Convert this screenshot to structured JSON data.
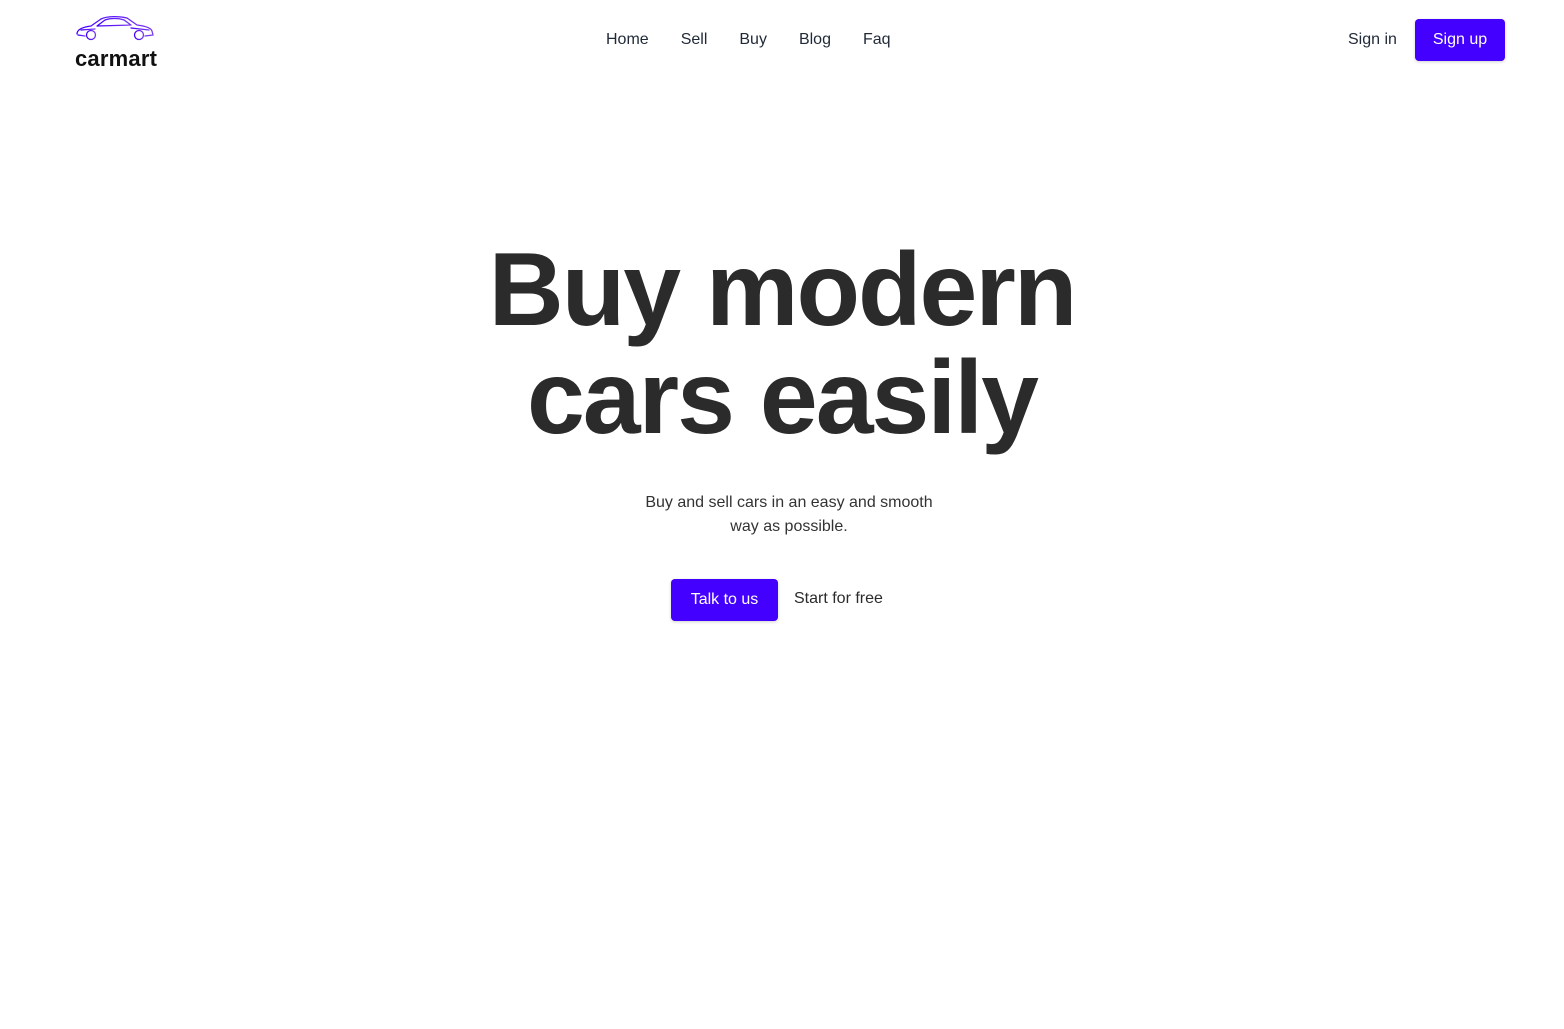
{
  "brand": {
    "name": "carmart",
    "logo_icon": "car-outline-icon",
    "logo_color": "#4300ff"
  },
  "nav": {
    "items": [
      {
        "label": "Home"
      },
      {
        "label": "Sell"
      },
      {
        "label": "Buy"
      },
      {
        "label": "Blog"
      },
      {
        "label": "Faq"
      }
    ]
  },
  "auth": {
    "signin_label": "Sign in",
    "signup_label": "Sign up"
  },
  "hero": {
    "title_line_1": "Buy modern",
    "title_line_2": "cars easily",
    "subtitle_line_1": "Buy and sell cars in an easy and smooth",
    "subtitle_line_2": "way as possible.",
    "primary_cta": "Talk to us",
    "secondary_cta": "Start for free"
  },
  "colors": {
    "accent": "#4300ff",
    "text": "#2b2b2b",
    "background": "#ffffff"
  }
}
